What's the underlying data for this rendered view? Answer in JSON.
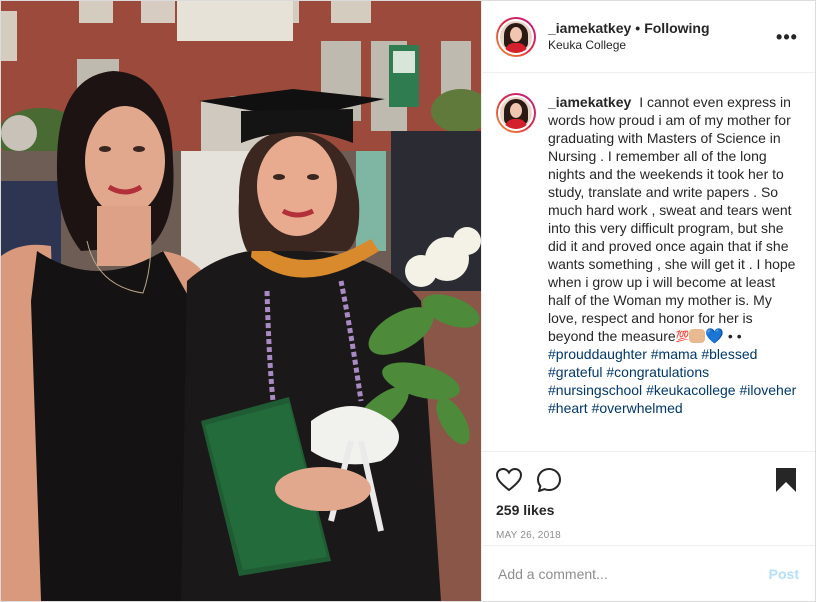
{
  "post": {
    "username": "_iamekatkey",
    "follow_label": "Following",
    "separator": "•",
    "location": "Keuka College",
    "more_label": "•••"
  },
  "caption": {
    "username": "_iamekatkey",
    "text": "I cannot even express in words how proud i am of my mother for graduating with Masters of Science in Nursing . I remember all of the long nights and the weekends it took her to study, translate and write papers . So much hard work , sweat and tears went into this very difficult program, but she did it and proved once again that if she wants something , she will get it . I hope when i grow up i will become at least half of the Woman my mother is. My love, respect and honor for her is beyond the measure",
    "emoji_100": "💯",
    "emoji_heart": "💙",
    "dots": "• •",
    "hashtags": [
      "#prouddaughter",
      "#mama",
      "#blessed",
      "#grateful",
      "#congratulations",
      "#nursingschool",
      "#keukacollege",
      "#iloveher",
      "#heart",
      "#overwhelmed"
    ]
  },
  "actions": {
    "likes": "259 likes",
    "date": "MAY 26, 2018"
  },
  "comment_box": {
    "placeholder": "Add a comment...",
    "post_label": "Post"
  },
  "icons": [
    "heart-icon",
    "comment-icon",
    "bookmark-icon",
    "more-options-icon"
  ]
}
